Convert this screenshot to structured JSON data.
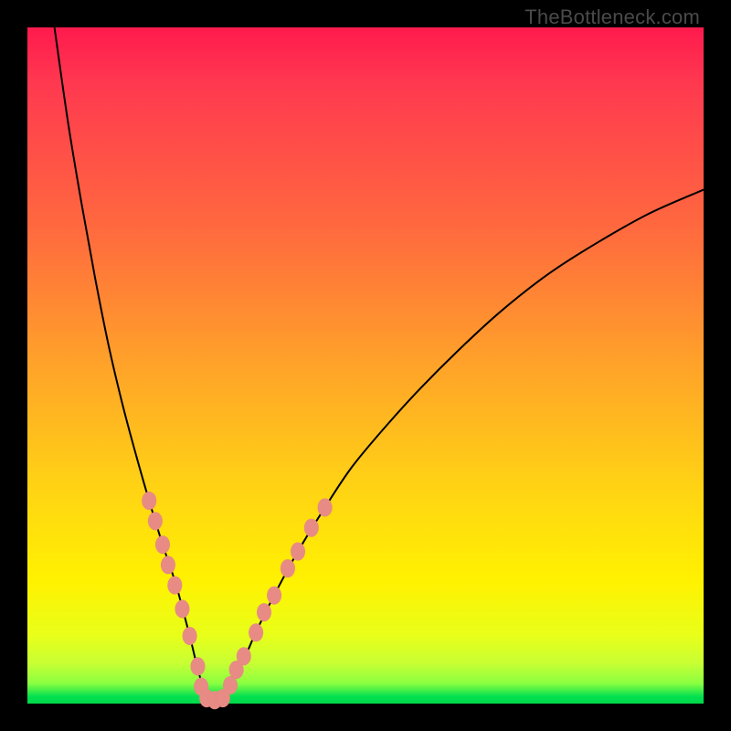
{
  "watermark": "TheBottleneck.com",
  "colors": {
    "frame_bg": "#000000",
    "gradient_top": "#ff1a4d",
    "gradient_mid1": "#ff6a3e",
    "gradient_mid2": "#ffd314",
    "gradient_low": "#fff200",
    "gradient_green": "#00d84a",
    "curve": "#000000",
    "markers": "#e88b85"
  },
  "chart_data": {
    "type": "line",
    "title": "",
    "xlabel": "",
    "ylabel": "",
    "xlim": [
      0,
      100
    ],
    "ylim": [
      0,
      100
    ],
    "notes": "V-shaped bottleneck curve on a red→green vertical gradient. Minimum around x≈26–29 at y≈0. Left arm rises steeply to y≈100 at x≈4; right arm rises more gently, reaching y≈76 at x≈100. Pink markers cluster along both arms in the lower ~30% of the plot and along the trough.",
    "series": [
      {
        "name": "bottleneck_curve_left",
        "x": [
          4,
          6,
          8,
          10,
          12,
          14,
          16,
          18,
          20,
          22,
          24,
          25.5,
          27
        ],
        "y": [
          100,
          86,
          74,
          63,
          53,
          44.5,
          37,
          30,
          23.5,
          17.5,
          10,
          4,
          0
        ]
      },
      {
        "name": "bottleneck_curve_right",
        "x": [
          28.5,
          30,
          32,
          34,
          37,
          40,
          44,
          48,
          53,
          58,
          64,
          70,
          77,
          84,
          92,
          100
        ],
        "y": [
          0,
          2.5,
          6.5,
          11,
          17,
          22.5,
          29,
          35,
          41,
          46.5,
          52.5,
          58,
          63.5,
          68,
          72.5,
          76
        ]
      }
    ],
    "markers": [
      {
        "x": 18.0,
        "y": 30.0
      },
      {
        "x": 18.9,
        "y": 27.0
      },
      {
        "x": 20.0,
        "y": 23.5
      },
      {
        "x": 20.8,
        "y": 20.5
      },
      {
        "x": 21.8,
        "y": 17.5
      },
      {
        "x": 22.9,
        "y": 14.0
      },
      {
        "x": 24.0,
        "y": 10.0
      },
      {
        "x": 25.2,
        "y": 5.5
      },
      {
        "x": 25.7,
        "y": 2.5
      },
      {
        "x": 26.5,
        "y": 0.8
      },
      {
        "x": 27.7,
        "y": 0.5
      },
      {
        "x": 28.9,
        "y": 0.8
      },
      {
        "x": 30.0,
        "y": 2.7
      },
      {
        "x": 30.9,
        "y": 5.0
      },
      {
        "x": 32.0,
        "y": 7.0
      },
      {
        "x": 33.8,
        "y": 10.5
      },
      {
        "x": 35.0,
        "y": 13.5
      },
      {
        "x": 36.5,
        "y": 16.0
      },
      {
        "x": 38.5,
        "y": 20.0
      },
      {
        "x": 40.0,
        "y": 22.5
      },
      {
        "x": 42.0,
        "y": 26.0
      },
      {
        "x": 44.0,
        "y": 29.0
      }
    ]
  }
}
